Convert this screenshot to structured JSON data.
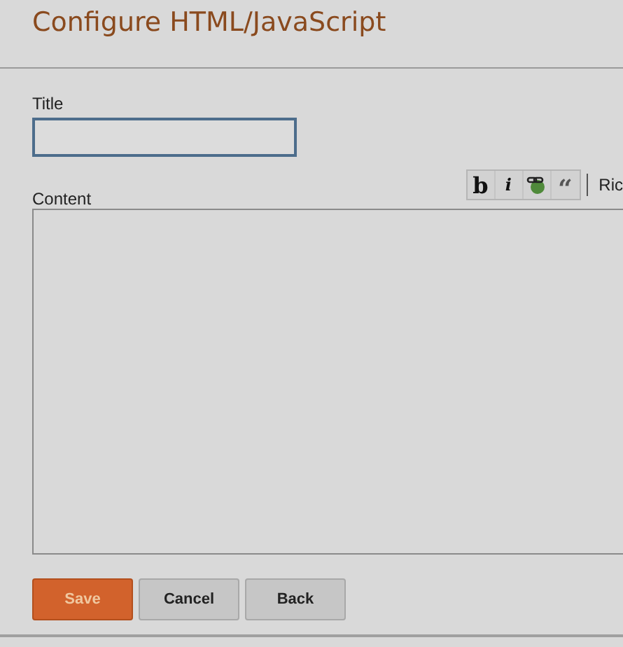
{
  "heading": "Configure HTML/JavaScript",
  "title_field": {
    "label": "Title"
  },
  "content_field": {
    "label": "Content"
  },
  "toolbar": [
    {
      "kind": "bold",
      "label": "b"
    },
    {
      "kind": "italic",
      "label": "i"
    },
    {
      "kind": "link"
    },
    {
      "kind": "quote",
      "label": "“"
    }
  ],
  "mode_link": "Ric",
  "buttons": [
    {
      "label": "Save",
      "kind": "primary"
    },
    {
      "label": "Cancel",
      "kind": "secondary"
    },
    {
      "label": "Back",
      "kind": "secondary"
    }
  ]
}
